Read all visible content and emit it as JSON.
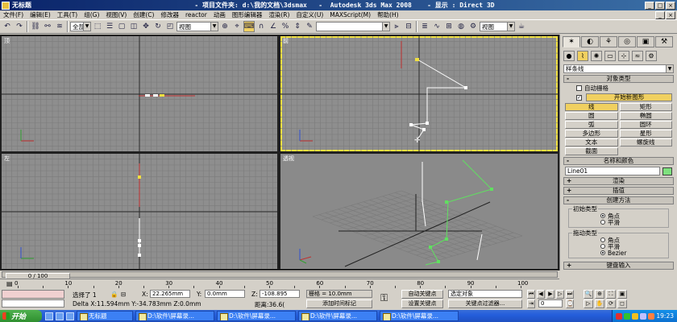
{
  "title": {
    "left": "无标题",
    "center": "- 项目文件夹: d:\\我的文档\\3dsmax   -  Autodesk 3ds Max 2008    - 显示 : Direct 3D"
  },
  "menu": [
    "文件(F)",
    "编辑(E)",
    "工具(T)",
    "组(G)",
    "视图(V)",
    "创建(C)",
    "修改器",
    "reactor",
    "动画",
    "图形编辑器",
    "渲染(R)",
    "自定义(U)",
    "MAXScript(M)",
    "帮助(H)"
  ],
  "toolbar": {
    "view_combo": "视图",
    "selection_set_combo": "",
    "icons": [
      "undo-icon",
      "redo-icon",
      "select-icon",
      "move-icon",
      "rotate-icon",
      "scale-icon"
    ]
  },
  "viewports": {
    "top": "顶",
    "front": "前",
    "left": "左",
    "perspective": "透视"
  },
  "command_panel": {
    "tabs": [
      "create-tab",
      "modify-tab",
      "hierarchy-tab",
      "motion-tab",
      "display-tab",
      "utilities-tab"
    ],
    "category_select": "样条线",
    "object_type": {
      "header": "对象类型",
      "auto_grid": "自动栅格",
      "start_new_shape": "开始新图形",
      "buttons": [
        {
          "label": "线",
          "active": true
        },
        {
          "label": "矩形",
          "active": false
        },
        {
          "label": "圆",
          "active": false
        },
        {
          "label": "椭圆",
          "active": false
        },
        {
          "label": "弧",
          "active": false
        },
        {
          "label": "圆环",
          "active": false
        },
        {
          "label": "多边形",
          "active": false
        },
        {
          "label": "星形",
          "active": false
        },
        {
          "label": "文本",
          "active": false
        },
        {
          "label": "螺旋线",
          "active": false
        },
        {
          "label": "截面",
          "active": false
        }
      ]
    },
    "name_color": {
      "header": "名称和颜色",
      "name": "Line01",
      "color": "#7ee07e"
    },
    "rendering": "渲染",
    "interpolation": "插值",
    "creation_method": {
      "header": "创建方法",
      "initial_type": {
        "title": "初始类型",
        "options": [
          {
            "label": "角点",
            "on": true
          },
          {
            "label": "平滑",
            "on": false
          }
        ]
      },
      "drag_type": {
        "title": "拖动类型",
        "options": [
          {
            "label": "角点",
            "on": false
          },
          {
            "label": "平滑",
            "on": false
          },
          {
            "label": "Bezier",
            "on": true
          }
        ]
      }
    },
    "keyboard_entry": "键盘输入"
  },
  "timeline": {
    "position": "0 / 100",
    "ticks": [
      "0",
      "10",
      "20",
      "30",
      "40",
      "50",
      "60",
      "70",
      "80",
      "90",
      "100"
    ]
  },
  "status": {
    "selected": "选择了 1",
    "x_label": "X:",
    "x": "22.265mm",
    "y_label": "Y:",
    "y": "0.0mm",
    "z_label": "Z:",
    "z": "-108.895",
    "grid": "栅格 = 10.0mm",
    "delta": "Delta X:11.594mm  Y:-34.783mm  Z:0.0mm",
    "distance": "距离:36.6(",
    "add_time_tag": "添加时间标记",
    "auto_key": "自动关键点",
    "set_key": "设置关键点",
    "selected_object": "选定对象",
    "key_filters": "关键点过滤器..."
  },
  "taskbar": {
    "start": "开始",
    "tasks": [
      "无标题",
      "D:\\软件\\屏幕录...",
      "D:\\软件\\屏幕录...",
      "D:\\软件\\屏幕录...",
      "D:\\软件\\屏幕录..."
    ],
    "clock": "19:23"
  }
}
